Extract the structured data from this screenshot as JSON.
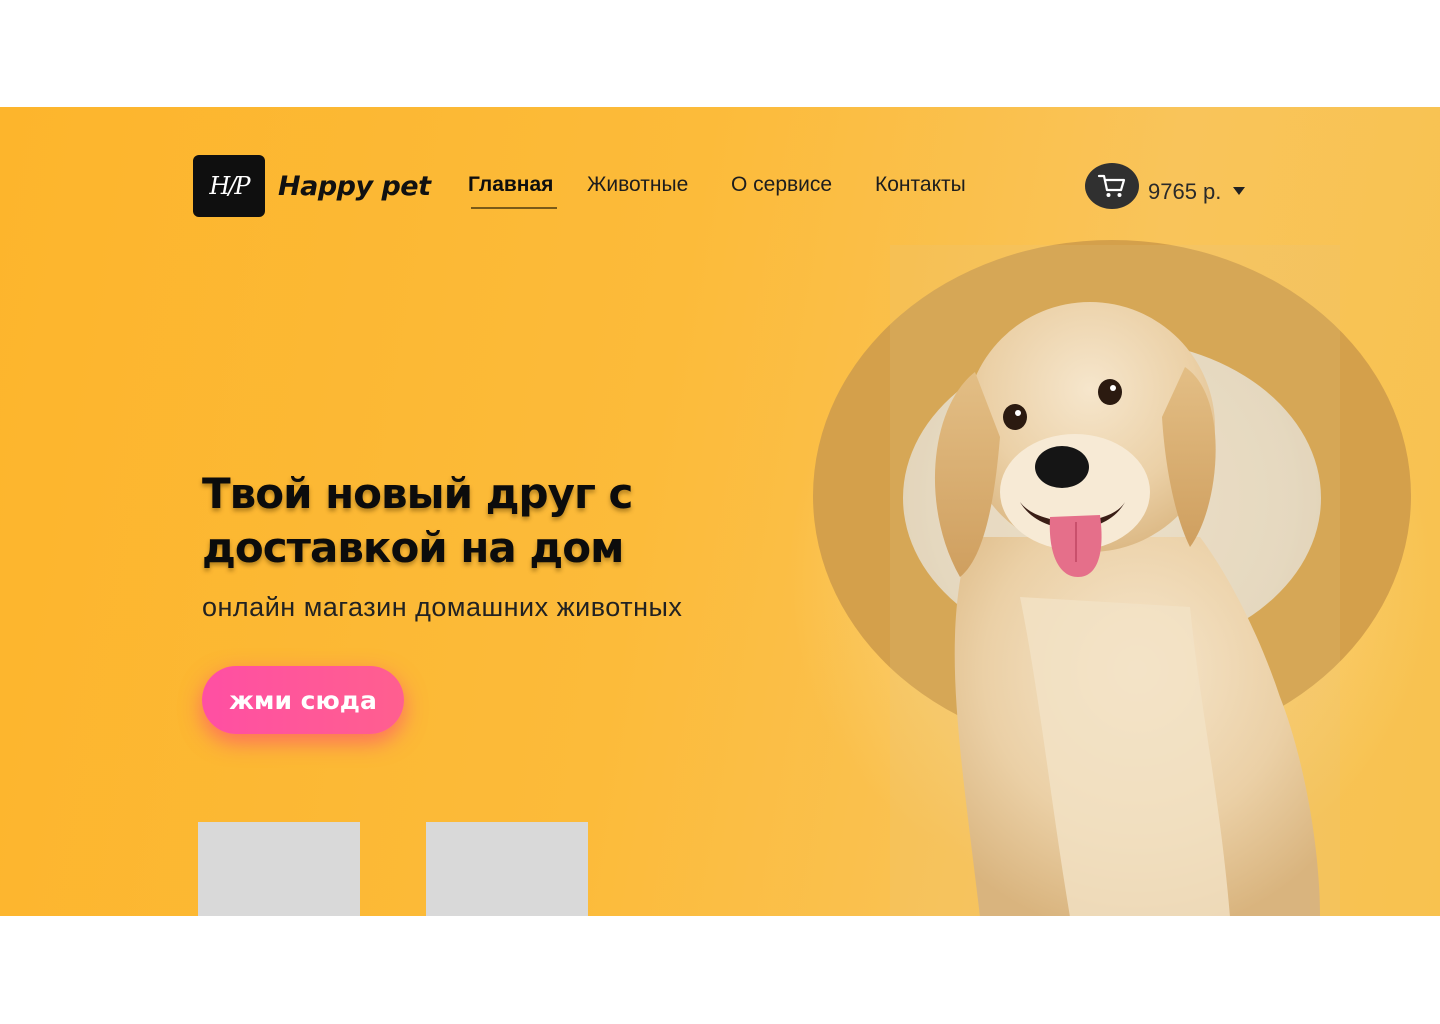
{
  "header": {
    "logo_text": "H/P",
    "brand": "Happy pet",
    "nav": [
      {
        "label": "Главная",
        "active": true
      },
      {
        "label": "Животные",
        "active": false
      },
      {
        "label": "О сервисе",
        "active": false
      },
      {
        "label": "Контакты",
        "active": false
      }
    ],
    "cart_icon": "shopping-cart-icon",
    "balance": "9765 р.",
    "balance_dropdown_icon": "caret-down-icon"
  },
  "hero": {
    "headline": "Твой новый друг с доставкой на дом",
    "subheadline": "онлайн магазин домашних животных",
    "cta_label": "жми сюда",
    "image": "golden-retriever-photo"
  },
  "colors": {
    "background": "#fdb52c",
    "ring": "#d4a04b",
    "cta": "#ff4fa3",
    "logo_bg": "#0f0f0f",
    "placeholder_card": "#d9d9d9"
  }
}
